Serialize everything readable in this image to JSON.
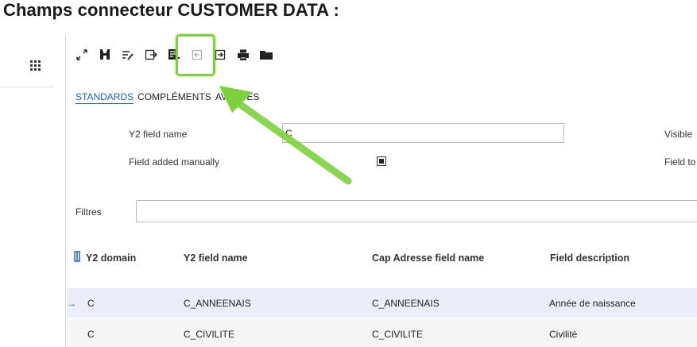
{
  "page_title": "Champs connecteur CUSTOMER DATA :",
  "toolbar": {
    "icons": [
      "expand-icon",
      "binoculars-icon",
      "edit-list-icon",
      "export-icon",
      "add-field-icon",
      "import-left-icon",
      "import-right-icon",
      "printer-icon",
      "folder-icon"
    ]
  },
  "tabs": [
    {
      "label": "STANDARDS",
      "active": true
    },
    {
      "label": "COMPLÉMENTS"
    },
    {
      "label": "AVANCÉS"
    }
  ],
  "form": {
    "y2_field_name_label": "Y2 field name",
    "y2_field_name_value": "C",
    "field_added_manually_label": "Field added manually",
    "field_added_manually_checked": true,
    "visible_label": "Visible",
    "field_to_label": "Field to"
  },
  "filters": {
    "label": "Filtres",
    "value": ""
  },
  "table": {
    "headers": [
      "Y2 domain",
      "Y2 field name",
      "Cap Adresse field name",
      "Field description"
    ],
    "rows": [
      {
        "domain": "C",
        "field": "C_ANNEENAIS",
        "cap_field": "C_ANNEENAIS",
        "description": "Année de naissance",
        "selected": true
      },
      {
        "domain": "C",
        "field": "C_CIVILITE",
        "cap_field": "C_CIVILITE",
        "description": "Civilité",
        "selected": false
      }
    ]
  },
  "colors": {
    "accent": "#1565c0",
    "highlight": "#7ed13c",
    "selected_row": "#e9eef8"
  }
}
